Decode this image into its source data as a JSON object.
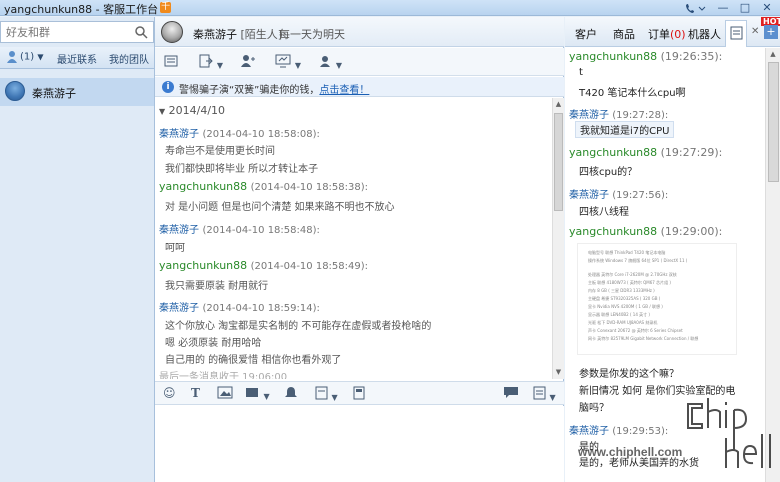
{
  "window": {
    "title": "yangchunkun88 - 客服工作台",
    "app_badge": "千"
  },
  "sidebar": {
    "search_placeholder": "好友和群",
    "tabs": [
      {
        "label": "(1)"
      },
      {
        "label": "最近联系"
      },
      {
        "label": "我的团队"
      }
    ],
    "contacts": [
      {
        "name": "秦燕游子"
      }
    ]
  },
  "chat": {
    "contact_name": "秦燕游子",
    "contact_tag": "[陌生人]",
    "contact_status": "每一天为明天",
    "notice_text": "警惕骗子演“双簧”骗走你的钱，",
    "notice_link": "点击查看！",
    "date": "2014/4/10",
    "messages": [
      {
        "who": "秦燕游子",
        "time": "(2014-04-10 18:58:08):",
        "lines": [
          "寿命岂不是使用更长时间",
          "我们都快即将毕业  所以才转让本子"
        ]
      },
      {
        "who": "yangchunkun88",
        "time": "(2014-04-10 18:58:38):",
        "lines": [
          "对  是小问题  但是也问个清楚  如果来路不明也不放心"
        ]
      },
      {
        "who": "秦燕游子",
        "time": "(2014-04-10 18:58:48):",
        "lines": [
          "呵呵"
        ]
      },
      {
        "who": "yangchunkun88",
        "time": "(2014-04-10 18:58:49):",
        "lines": [
          "我只需要原装 耐用就行"
        ]
      },
      {
        "who": "秦燕游子",
        "time": "(2014-04-10 18:59:14):",
        "lines": [
          "这个你放心 淘宝都是实名制的 不可能存在虚假或者投枪啥的",
          "嗯 必须原装 耐用哈哈",
          "自己用的 的确很爱惜 相信你也看外观了"
        ]
      }
    ],
    "last_msg_note": "最后一条消息收于 19:06:00"
  },
  "right_panel": {
    "tabs": [
      {
        "label": "客户"
      },
      {
        "label": "商品"
      },
      {
        "label": "订单",
        "count": "(0)"
      },
      {
        "label": "机器人"
      }
    ],
    "hot_label": "HOT",
    "messages": [
      {
        "who": "yangchunkun88",
        "time": "(19:26:35):",
        "lines": [
          "t",
          "T420 笔记本什么cpu啊"
        ]
      },
      {
        "who": "秦燕游子",
        "time": "(19:27:28):",
        "lines": [
          "我就知道是i7的CPU"
        ]
      },
      {
        "who": "yangchunkun88",
        "time": "(19:27:29):",
        "lines": [
          "四核cpu的？"
        ]
      },
      {
        "who": "秦燕游子",
        "time": "(19:27:56):",
        "lines": [
          "四核八线程"
        ]
      },
      {
        "who": "yangchunkun88",
        "time": "(19:29:00):",
        "lines": []
      },
      {
        "who": "",
        "time": "",
        "lines": [
          "参数是你发的这个嘛？",
          "新旧情况 如何   是你们实验室配的电",
          "脑吗？"
        ]
      },
      {
        "who": "秦燕游子",
        "time": "(19:29:53):",
        "lines": [
          "是的",
          "是的，老师从美国弄的水货"
        ]
      }
    ],
    "image_lines": [
      "电脑型号  联想 ThinkPad T420 笔记本电脑",
      "操作系统  Windows 7 旗舰版 64位 SP1 ( DirectX 11 )",
      "处理器  英特尔 Core i7-2620M @ 2.70GHz 双核",
      "主板  联想 4180W73 ( 英特尔 QM67 芯片组 )",
      "内存  8 GB ( 三星 DDR3 1333MHz )",
      "主硬盘  希捷 ST9320325AS ( 320 GB )",
      "显卡  Nvidia NVS 4200M ( 1 GB / 联想 )",
      "显示器  联想 LEN40B2 ( 14 英寸 )",
      "光驱  松下 DVD-RAM UJ8A0AS 刻录机",
      "声卡  Conexant 20672 @ 英特尔 6 Series Chipset",
      "网卡  英特尔 82579LM Gigabit Network Connection / 联想"
    ],
    "watermark_url": "www.chiphell.com"
  }
}
